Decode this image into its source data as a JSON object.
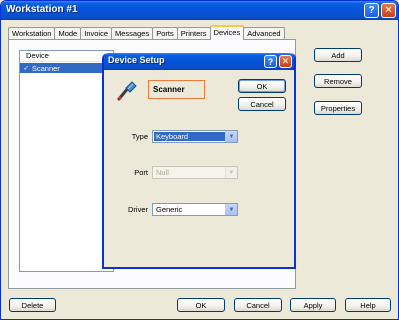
{
  "window": {
    "title": "Workstation #1",
    "help_glyph": "?",
    "close_glyph": "✕"
  },
  "tabs": [
    "Workstation",
    "Mode",
    "Invoice",
    "Messages",
    "Ports",
    "Printers",
    "Devices",
    "Advanced"
  ],
  "active_tab": "Devices",
  "device_list": {
    "header": "Device",
    "items": [
      {
        "icon": "device-arrow-icon",
        "label": "Scanner",
        "selected": true
      }
    ]
  },
  "side_buttons": {
    "add": "Add",
    "remove": "Remove",
    "properties": "Properties"
  },
  "footer_buttons": {
    "delete": "Delete",
    "ok": "OK",
    "cancel": "Cancel",
    "apply": "Apply",
    "help": "Help"
  },
  "dialog": {
    "title": "Device Setup",
    "help_glyph": "?",
    "close_glyph": "✕",
    "icon": "scanner-icon",
    "device_name": "Scanner",
    "ok": "OK",
    "cancel": "Cancel",
    "type_label": "Type",
    "type_value": "Keyboard",
    "port_label": "Port",
    "port_value": "Null",
    "driver_label": "Driver",
    "driver_value": "Generic"
  },
  "colors": {
    "title_blue": "#0453d8",
    "selection": "#316ac5",
    "highlight_border": "#ee7a3c"
  }
}
